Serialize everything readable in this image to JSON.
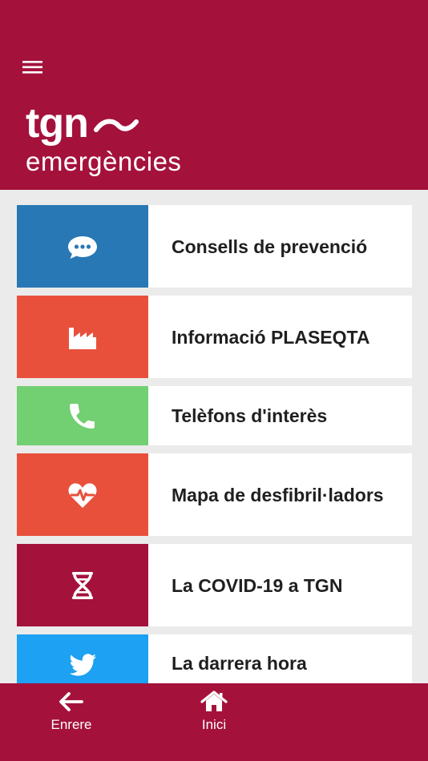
{
  "header": {
    "logo_main": "tgn",
    "logo_sub": "emergències",
    "background_color": "#a4123c",
    "menu_icon": "hamburger-icon"
  },
  "menu": {
    "items": [
      {
        "label": "Consells de prevenció",
        "icon": "chat-bubble-icon",
        "color": "#2878b5"
      },
      {
        "label": "Informació PLASEQTA",
        "icon": "factory-icon",
        "color": "#e8503c"
      },
      {
        "label": "Telèfons d'interès",
        "icon": "phone-icon",
        "color": "#72cf72"
      },
      {
        "label": "Mapa de desfibril·ladors",
        "icon": "heartbeat-icon",
        "color": "#e8503c"
      },
      {
        "label": "La COVID-19 a TGN",
        "icon": "dna-icon",
        "color": "#a4123c"
      },
      {
        "label": "La darrera hora",
        "icon": "twitter-icon",
        "color": "#1da1f2"
      }
    ]
  },
  "bottom_nav": {
    "back_label": "Enrere",
    "home_label": "Inici"
  }
}
